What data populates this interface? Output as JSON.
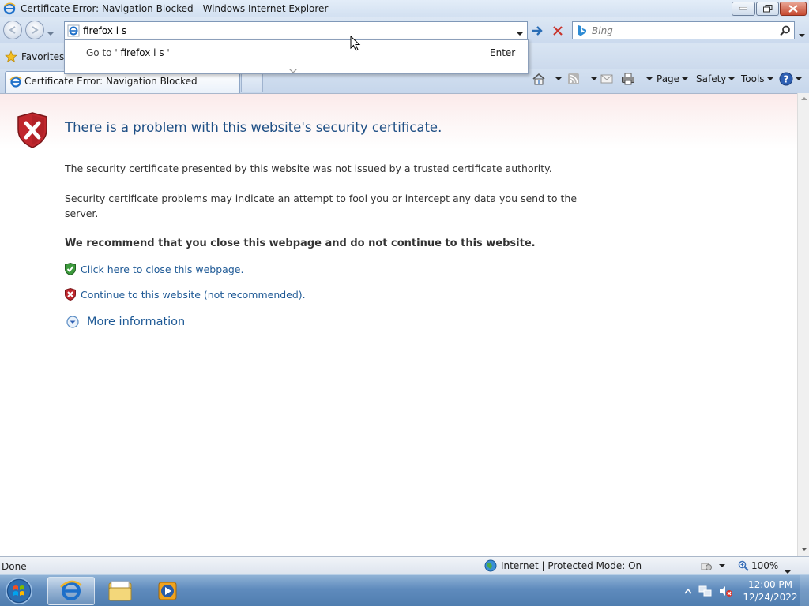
{
  "window": {
    "title": "Certificate Error: Navigation Blocked - Windows Internet Explorer"
  },
  "address_bar": {
    "value": "firefox i s"
  },
  "autocomplete": {
    "goto_prefix": "Go to '",
    "goto_value": " firefox i s ",
    "goto_suffix": "'",
    "enter_label": "Enter"
  },
  "search": {
    "placeholder": "Bing"
  },
  "favorites": {
    "label": "Favorites"
  },
  "tab": {
    "label": "Certificate Error: Navigation Blocked"
  },
  "command_bar": {
    "page_label": "Page",
    "safety_label": "Safety",
    "tools_label": "Tools"
  },
  "content": {
    "heading": "There is a problem with this website's security certificate.",
    "paragraph1": "The security certificate presented by this website was not issued by a trusted certificate authority.",
    "paragraph2": "Security certificate problems may indicate an attempt to fool you or intercept any data you send to the server.",
    "recommendation": "We recommend that you close this webpage and do not continue to this website.",
    "close_link": "Click here to close this webpage.",
    "continue_link": "Continue to this website (not recommended).",
    "more_info": "More information"
  },
  "status_bar": {
    "left_text": "Done",
    "zone_text": "Internet | Protected Mode: On",
    "zoom": "100%"
  },
  "taskbar": {
    "time": "12:00 PM",
    "date": "12/24/2022"
  },
  "colors": {
    "heading_blue": "#1f4f85",
    "link_blue": "#1f5a96",
    "shield_red": "#c0272d",
    "shield_green": "#3c9a3c"
  }
}
